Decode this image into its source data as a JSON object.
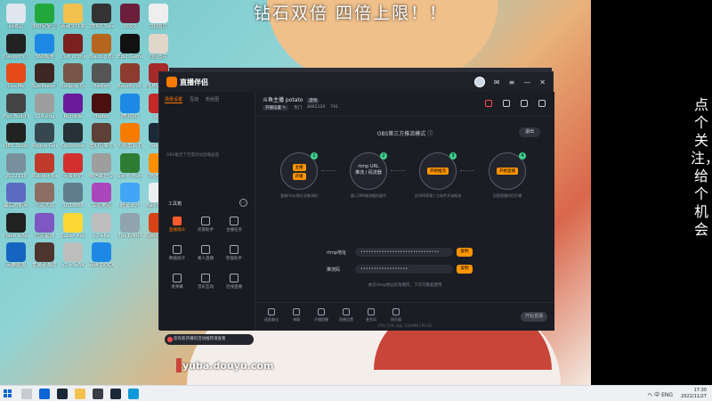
{
  "banner": {
    "text": "钻石双倍 四倍上限！！"
  },
  "side_text": "点个关注，给个机会",
  "desktop_icons": [
    {
      "label": "回收站",
      "color": "#dfe6ee"
    },
    {
      "label": "360安全卫士",
      "color": "#22a83a"
    },
    {
      "label": "新建文件夹",
      "color": "#f2c14e"
    },
    {
      "label": "ZERO Sievert",
      "color": "#333"
    },
    {
      "label": "2020",
      "color": "#6b1f3a"
    },
    {
      "label": "QQ图片",
      "color": "#eee"
    },
    {
      "label": "Despot's Game",
      "color": "#222"
    },
    {
      "label": "360极速",
      "color": "#1e88e5"
    },
    {
      "label": "Cult of the Lamb",
      "color": "#7b1f1f"
    },
    {
      "label": "Blazing Books",
      "color": "#b5651d"
    },
    {
      "label": "Epic Games Launcher",
      "color": "#111"
    },
    {
      "label": "QQ图片",
      "color": "#e0d6c9"
    },
    {
      "label": "LiveMe",
      "color": "#e64a19"
    },
    {
      "label": "Spellkeon Demonic",
      "color": "#3e2723"
    },
    {
      "label": "Solipop Demo",
      "color": "#795548"
    },
    {
      "label": "Hadlen",
      "color": "#555"
    },
    {
      "label": "Bounty of One",
      "color": "#8d3b2f"
    },
    {
      "label": "HUMANKIND",
      "color": "#a52a2a"
    },
    {
      "label": "Fan Build Pearl",
      "color": "#444"
    },
    {
      "label": "10A.png",
      "color": "#9e9e9e"
    },
    {
      "label": "Rumble",
      "color": "#6a1b9a"
    },
    {
      "label": "Hades",
      "color": "#4a1010"
    },
    {
      "label": "腾讯QQ",
      "color": "#1e88e5"
    },
    {
      "label": "盒子",
      "color": "#c62828"
    },
    {
      "label": "OBS Studio",
      "color": "#222"
    },
    {
      "label": "Rogue Genesia",
      "color": "#37474f"
    },
    {
      "label": "Soulstone Survivors",
      "color": "#263238"
    },
    {
      "label": "虚幻引擎 Demo",
      "color": "#5d4037"
    },
    {
      "label": "火焰重启 Demo",
      "color": "#f57c00"
    },
    {
      "label": "Steam",
      "color": "#1b2838"
    },
    {
      "label": "2022110",
      "color": "#78909c"
    },
    {
      "label": "Rubber Bandits",
      "color": "#c0392b"
    },
    {
      "label": "无畏契约",
      "color": "#d32f2f"
    },
    {
      "label": "微信截图 2022",
      "color": "#9e9e9e"
    },
    {
      "label": "Spirit Hunter",
      "color": "#2e7d32"
    },
    {
      "label": "烧烤兄弟",
      "color": "#ff8f00"
    },
    {
      "label": "最后的机甲",
      "color": "#5c6bc0"
    },
    {
      "label": "小鸡大战",
      "color": "#8d6e63"
    },
    {
      "label": "3D1BWR",
      "color": "#607d8b"
    },
    {
      "label": "幸运地道",
      "color": "#ab47bc"
    },
    {
      "label": "超星上升",
      "color": "#42a5f5"
    },
    {
      "label": "Bad North",
      "color": "#eceff1"
    },
    {
      "label": "Have a Nice Death",
      "color": "#212121"
    },
    {
      "label": "巴克星球",
      "color": "#7e57c2"
    },
    {
      "label": "Super Auto Pets",
      "color": "#fdd835"
    },
    {
      "label": "v2-e6e",
      "color": "#bdbdbd"
    },
    {
      "label": "7be1c404",
      "color": "#90a4ae"
    },
    {
      "label": "Spelunky 2",
      "color": "#d84315"
    },
    {
      "label": "英雄联盟",
      "color": "#1565c0"
    },
    {
      "label": "重装者游戏 Demo",
      "color": "#4e342e"
    },
    {
      "label": "v2-e9e54",
      "color": "#bdbdbd"
    },
    {
      "label": "新建 DOCX 文档",
      "color": "#1e88e5"
    }
  ],
  "app": {
    "brand": "直播伴侣",
    "left_tabs": [
      "场景设置",
      "互动",
      "粉丝团"
    ],
    "scene_hint": "OBS推流下无需添加直播画面",
    "tools_title": "工具箱",
    "tools": [
      {
        "label": "直播观众",
        "hot": true
      },
      {
        "label": "房管助手",
        "hot": false
      },
      {
        "label": "主播任务",
        "hot": false
      },
      {
        "label": "数据统计",
        "hot": false
      },
      {
        "label": "素人直播",
        "hot": false
      },
      {
        "label": "智能助手",
        "hot": false
      },
      {
        "label": "发弹幕",
        "hot": false
      },
      {
        "label": "音乐互动",
        "hot": false
      },
      {
        "label": "连线直播",
        "hot": false
      }
    ],
    "notice": "您有新开播的活动推荐请查看",
    "room": {
      "name": "斗鱼主播 potato",
      "tag": "游戏",
      "edit": "开播设置 ✎",
      "meta": [
        "热门",
        "8462120",
        "741"
      ]
    },
    "obs_title": "OBS第三方推流模式 ⓘ",
    "exit": "退出",
    "steps": [
      {
        "num": "1",
        "btns": [
          "主播",
          "开播"
        ],
        "desc": "复制rtmp地址及推流码"
      },
      {
        "num": "2",
        "text": "rtmp URL",
        "sub": "推流 / 码流器",
        "desc": "填入OBS推流服务器中"
      },
      {
        "num": "3",
        "btns": [
          "开始推流"
        ],
        "desc": "在OBS等第三方软件开始推流"
      },
      {
        "num": "4",
        "btns": [
          "开始直播"
        ],
        "desc": "回到直播伴侣开播"
      }
    ],
    "rtmp_label": "rtmp地址",
    "rtmp_value": "••••••••••••••••••••••••••••••",
    "key_label": "推流码",
    "key_value": "••••••••••••••••••",
    "copy_label": "复制",
    "tip": "本次rtmp地址有效期内，下次可重复使用",
    "bottom_buttons": [
      "画面美化",
      "弹幕",
      "开播提醒",
      "直播设置",
      "麦克风",
      "扬声器"
    ],
    "live_btn": "开始直播",
    "status": "CPU 10%  内存 1500MB  FPS 60"
  },
  "watermark": "yuba.douyu.com",
  "taskbar": {
    "time": "17:30",
    "date": "2022/11/27",
    "tray": "ヘ 中 ENG"
  }
}
